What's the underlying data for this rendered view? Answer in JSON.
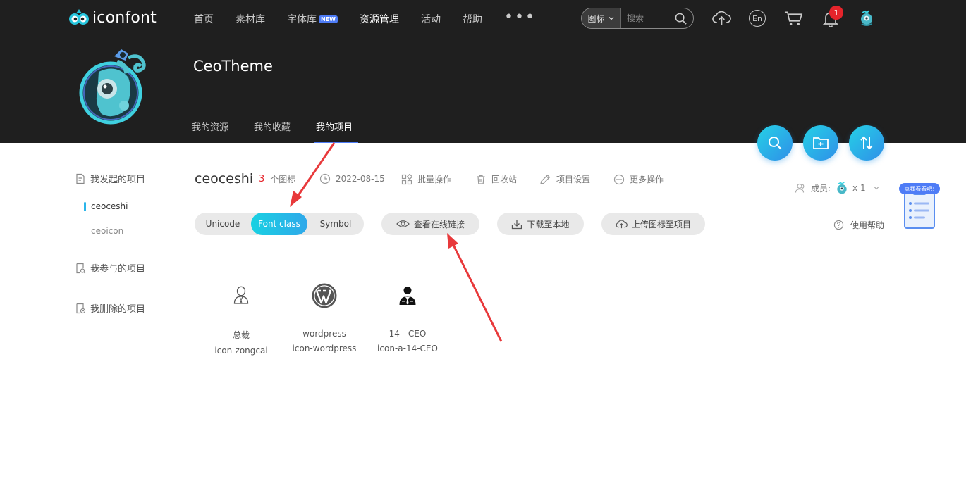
{
  "brand": {
    "name": "iconfont"
  },
  "nav": {
    "items": [
      {
        "label": "首页"
      },
      {
        "label": "素材库"
      },
      {
        "label": "字体库",
        "badge": "NEW"
      },
      {
        "label": "资源管理",
        "active": true
      },
      {
        "label": "活动"
      },
      {
        "label": "帮助"
      }
    ],
    "more": "•••"
  },
  "search": {
    "type": "图标",
    "placeholder": "搜索"
  },
  "toolbar": {
    "notification_count": "1",
    "language": "En"
  },
  "profile": {
    "name": "CeoTheme",
    "tabs": [
      {
        "label": "我的资源"
      },
      {
        "label": "我的收藏"
      },
      {
        "label": "我的项目",
        "active": true
      }
    ]
  },
  "sidebar": {
    "started": "我发起的项目",
    "projects": [
      "ceoceshi",
      "ceoicon"
    ],
    "joined": "我参与的项目",
    "deleted": "我删除的项目"
  },
  "project": {
    "name": "ceoceshi",
    "count": "3",
    "count_label": "个图标",
    "date": "2022-08-15",
    "batch": "批量操作",
    "recycle": "回收站",
    "settings": "项目设置",
    "more": "更多操作",
    "members_label": "成员:",
    "members_count": "x 1",
    "help": "使用帮助",
    "widget_label": "点我看看吧!"
  },
  "format_tabs": [
    "Unicode",
    "Font class",
    "Symbol"
  ],
  "actions": {
    "view_link": "查看在线链接",
    "download": "下载至本地",
    "upload": "上传图标至项目"
  },
  "icons": [
    {
      "name": "总裁",
      "code": "icon-zongcai"
    },
    {
      "name": "wordpress",
      "code": "icon-wordpress"
    },
    {
      "name": "14 - CEO",
      "code": "icon-a-14-CEO"
    }
  ],
  "colors": {
    "accent": "#2fa8ea",
    "header_bg": "#1f1f1f",
    "annotation": "#e8393b"
  }
}
